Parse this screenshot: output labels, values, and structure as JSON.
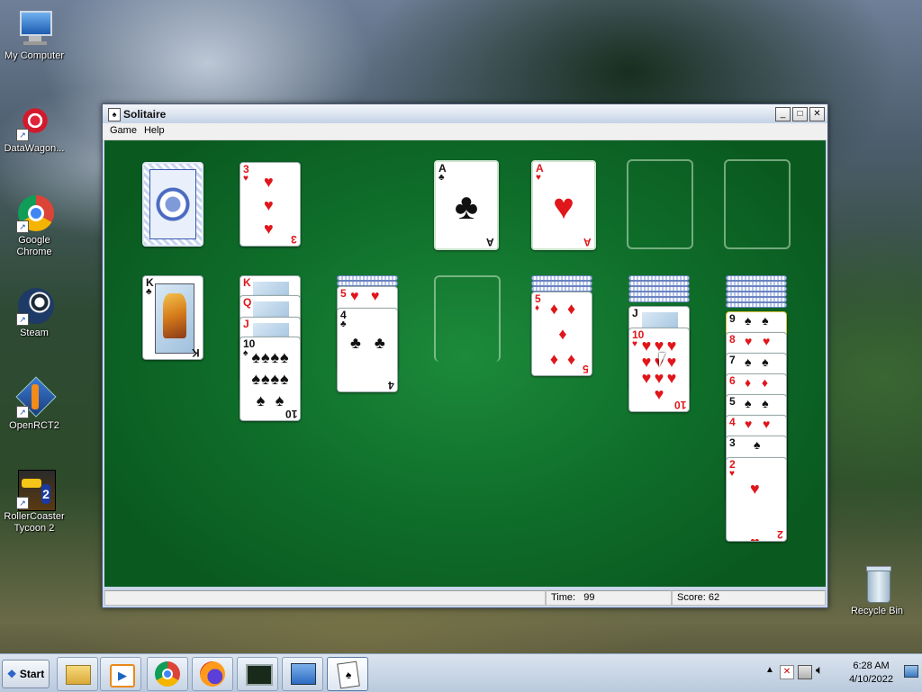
{
  "desktop": {
    "icons": [
      {
        "label": "My Computer"
      },
      {
        "label": "DataWagon..."
      },
      {
        "label": "Google Chrome"
      },
      {
        "label": "Steam"
      },
      {
        "label": "OpenRCT2"
      },
      {
        "label": "RollerCoaster Tycoon 2"
      },
      {
        "label": "Recycle Bin"
      }
    ]
  },
  "window": {
    "title": "Solitaire",
    "menu": [
      "Game",
      "Help"
    ],
    "controls": {
      "minimize": "_",
      "maximize": "□",
      "close": "✕"
    }
  },
  "game": {
    "waste_top": {
      "rank": "3",
      "suit": "♥"
    },
    "foundations": [
      {
        "rank": "A",
        "suit": "♣"
      },
      {
        "rank": "A",
        "suit": "♥"
      }
    ],
    "tableau": {
      "col1": [
        {
          "rank": "K",
          "suit": "♣"
        }
      ],
      "col2": [
        {
          "rank": "K",
          "suit": "♥"
        },
        {
          "rank": "Q",
          "suit": "♥"
        },
        {
          "rank": "J",
          "suit": "♥"
        },
        {
          "rank": "10",
          "suit": "♠"
        }
      ],
      "col3": [
        {
          "rank": "5",
          "suit": "♥"
        },
        {
          "rank": "4",
          "suit": "♣"
        }
      ],
      "col5": [
        {
          "rank": "5",
          "suit": "♦"
        }
      ],
      "col6": [
        {
          "rank": "J",
          "suit": "♠"
        },
        {
          "rank": "10",
          "suit": "♥"
        }
      ],
      "col7": [
        {
          "rank": "9",
          "suit": "♠"
        },
        {
          "rank": "8",
          "suit": "♥"
        },
        {
          "rank": "7",
          "suit": "♠"
        },
        {
          "rank": "6",
          "suit": "♦"
        },
        {
          "rank": "5",
          "suit": "♠"
        },
        {
          "rank": "4",
          "suit": "♥"
        },
        {
          "rank": "3",
          "suit": "♠"
        },
        {
          "rank": "2",
          "suit": "♥"
        }
      ]
    }
  },
  "status": {
    "time_label": "Time:",
    "time_value": "99",
    "score_label": "Score:",
    "score_value": "62"
  },
  "taskbar": {
    "start_label": "Start",
    "clock_time": "6:28 AM",
    "clock_date": "4/10/2022"
  },
  "colors": {
    "felt": "#0f6e2a",
    "red_suit": "#e0161a",
    "black_suit": "#111111"
  }
}
